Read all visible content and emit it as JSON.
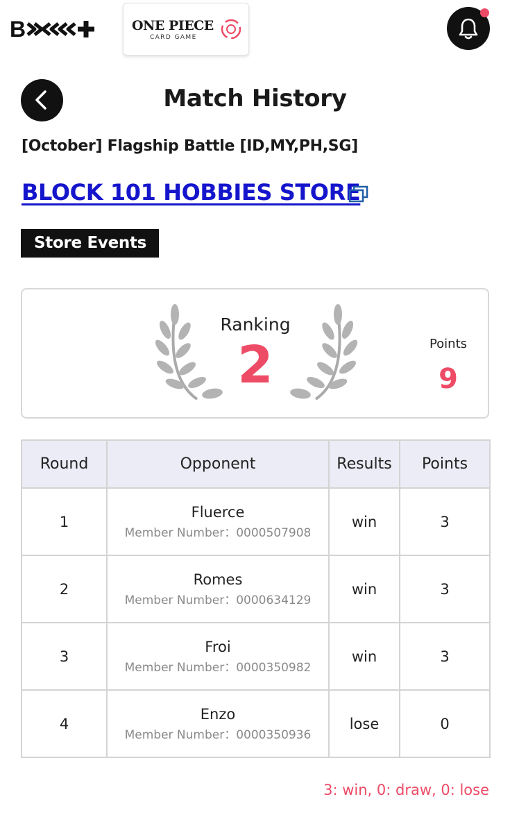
{
  "header": {
    "bcg_logo_text": "BCG+",
    "card_game_logo": {
      "title": "ONE PIECE",
      "subtitle": "CARD GAME"
    },
    "notification_dot_color": "#ee4b66"
  },
  "page": {
    "title": "Match History",
    "event_name": "[October] Flagship Battle [ID,MY,PH,SG]",
    "store_name": "BLOCK 101 HOBBIES STORE",
    "event_type_badge": "Store Events"
  },
  "summary": {
    "ranking_label": "Ranking",
    "ranking_value": "2",
    "points_label": "Points",
    "points_value": "9"
  },
  "table": {
    "headers": [
      "Round",
      "Opponent",
      "Results",
      "Points"
    ],
    "member_label": "Member Number：",
    "rows": [
      {
        "round": "1",
        "opponent": "Fluerce",
        "member_number": "0000507908",
        "result": "win",
        "points": "3"
      },
      {
        "round": "2",
        "opponent": "Romes",
        "member_number": "0000634129",
        "result": "win",
        "points": "3"
      },
      {
        "round": "3",
        "opponent": "Froi",
        "member_number": "0000350982",
        "result": "win",
        "points": "3"
      },
      {
        "round": "4",
        "opponent": "Enzo",
        "member_number": "0000350936",
        "result": "lose",
        "points": "0"
      }
    ]
  },
  "legend": "3: win, 0: draw, 0: lose",
  "colors": {
    "accent": "#ee4b66",
    "link": "#1515cc",
    "header_row_bg": "#ececf7",
    "dark": "#111111"
  },
  "icons": {
    "back": "chevron-left-icon",
    "notifications": "bell-icon",
    "external_link": "external-link-icon",
    "laurel": "laurel-wreath-icon"
  }
}
